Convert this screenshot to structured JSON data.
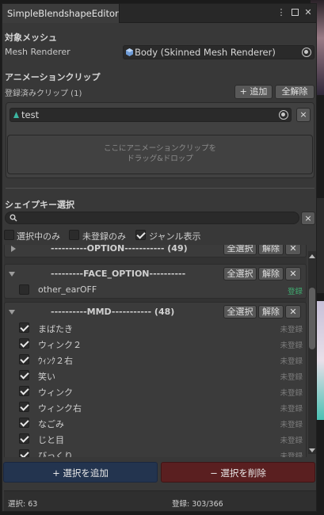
{
  "window": {
    "tab_title": "SimpleBlendshapeEditor"
  },
  "target": {
    "section_title": "対象メッシュ",
    "label": "Mesh Renderer",
    "value": "Body (Skinned Mesh Renderer)"
  },
  "clips": {
    "section_title": "アニメーションクリップ",
    "registered_label": "登録済みクリップ (1)",
    "add_button": "+ 追加",
    "clear_button": "全解除",
    "items": [
      {
        "name": "test"
      }
    ],
    "remove_button": "×",
    "dropzone_line1": "ここにアニメーションクリップを",
    "dropzone_line2": "ドラッグ&ドロップ"
  },
  "shapekey": {
    "section_title": "シェイプキー選択",
    "search_value": "",
    "clear_search": "×",
    "filters": [
      {
        "label": "選択中のみ",
        "checked": false
      },
      {
        "label": "未登録のみ",
        "checked": false
      },
      {
        "label": "ジャンル表示",
        "checked": true
      }
    ],
    "group_buttons": {
      "select_all": "全選択",
      "deselect": "解除",
      "close": "✕"
    },
    "groups": [
      {
        "title": "----------OPTION----------- (49)",
        "expanded": false,
        "rows": []
      },
      {
        "title": "---------FACE_OPTION----------",
        "expanded": true,
        "rows": [
          {
            "name": "other_earOFF",
            "checked": false,
            "status": "登録"
          }
        ]
      },
      {
        "title": "----------MMD----------- (48)",
        "expanded": true,
        "rows": [
          {
            "name": "まばたき",
            "checked": true,
            "status": "未登録"
          },
          {
            "name": "ウィンク２",
            "checked": true,
            "status": "未登録"
          },
          {
            "name": "ｳｨﾝｸ２右",
            "checked": true,
            "status": "未登録"
          },
          {
            "name": "笑い",
            "checked": true,
            "status": "未登録"
          },
          {
            "name": "ウィンク",
            "checked": true,
            "status": "未登録"
          },
          {
            "name": "ウィンク右",
            "checked": true,
            "status": "未登録"
          },
          {
            "name": "なごみ",
            "checked": true,
            "status": "未登録"
          },
          {
            "name": "じと目",
            "checked": true,
            "status": "未登録"
          },
          {
            "name": "びっくり",
            "checked": true,
            "status": "未登録"
          }
        ]
      }
    ]
  },
  "actions": {
    "add_selection": "+ 選択を追加",
    "remove_selection": "− 選択を削除"
  },
  "footer": {
    "selected": "選択: 63",
    "registered": "登録: 303/366"
  },
  "colors": {
    "add_button_bg": "#23344f",
    "remove_button_bg": "#5a1f20",
    "registered_status": "#3fa96f"
  }
}
